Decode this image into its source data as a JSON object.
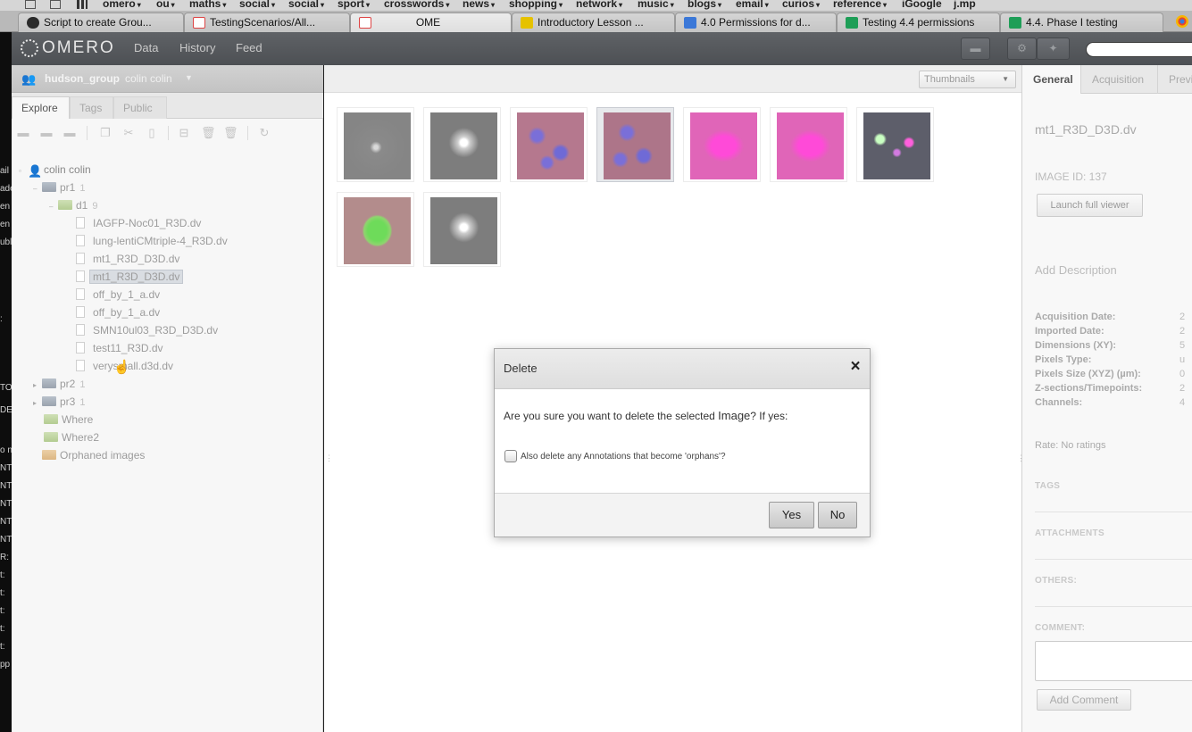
{
  "browser": {
    "bookmarks": [
      {
        "label": "omero",
        "caret": "▾"
      },
      {
        "label": "ou",
        "caret": "▾"
      },
      {
        "label": "maths",
        "caret": "▾"
      },
      {
        "label": "social",
        "caret": "▾"
      },
      {
        "label": "social",
        "caret": "▾"
      },
      {
        "label": "sport",
        "caret": "▾"
      },
      {
        "label": "crosswords",
        "caret": "▾"
      },
      {
        "label": "news",
        "caret": "▾"
      },
      {
        "label": "shopping",
        "caret": "▾"
      },
      {
        "label": "network",
        "caret": "▾"
      },
      {
        "label": "music",
        "caret": "▾"
      },
      {
        "label": "blogs",
        "caret": "▾"
      },
      {
        "label": "email",
        "caret": "▾"
      },
      {
        "label": "curios",
        "caret": "▾"
      },
      {
        "label": "reference",
        "caret": "▾"
      },
      {
        "label": "iGoogle",
        "caret": ""
      },
      {
        "label": "j.mp",
        "caret": ""
      }
    ],
    "tabs": [
      {
        "label": "Script to create Grou...",
        "fav_color": "#2b2b2b"
      },
      {
        "label": "TestingScenarios/All...",
        "fav_color": "#ffffff"
      },
      {
        "label": "OME",
        "fav_color": "#ffffff"
      },
      {
        "label": "Introductory Lesson ...",
        "fav_color": "#e6c200"
      },
      {
        "label": "4.0 Permissions for d...",
        "fav_color": "#3b78d8"
      },
      {
        "label": "Testing 4.4 permissions",
        "fav_color": "#1e9e57"
      },
      {
        "label": "4.4. Phase I testing",
        "fav_color": "#1e9e57"
      }
    ]
  },
  "desktop_strip": [
    "ail",
    "ade",
    "en",
    "en",
    "ubl",
    ":",
    "TO",
    "DE",
    "o n",
    "NT",
    "NT",
    "NT",
    "NT",
    "NT",
    "R:",
    "t: ",
    "t: ",
    "t: ",
    "t: ",
    "t: ",
    "pp"
  ],
  "header": {
    "logo_text": "OMERO",
    "nav": [
      "Data",
      "History",
      "Feed"
    ]
  },
  "left": {
    "group": "hudson_group",
    "user": "colin colin",
    "group_caret": "▼",
    "tabs": [
      "Explore",
      "Tags",
      "Public"
    ],
    "tree": {
      "root": "colin colin",
      "pr1": {
        "label": "pr1",
        "count": "1"
      },
      "d1": {
        "label": "d1",
        "count": "9"
      },
      "images": [
        "IAGFP-Noc01_R3D.dv",
        "lung-lentiCMtriple-4_R3D.dv",
        "mt1_R3D_D3D.dv",
        "mt1_R3D_D3D.dv",
        "off_by_1_a.dv",
        "off_by_1_a.dv",
        "SMN10ul03_R3D_D3D.dv",
        "test11_R3D.dv",
        "verysmall.d3d.dv"
      ],
      "pr2": {
        "label": "pr2",
        "count": "1"
      },
      "pr3": {
        "label": "pr3",
        "count": "1"
      },
      "where": "Where",
      "where2": "Where2",
      "orphaned": "Orphaned images"
    }
  },
  "center": {
    "view_select": "Thumbnails",
    "selected_thumbnail_index": 3
  },
  "dialog": {
    "title": "Delete",
    "question_pre": "Are you sure you want to delete the selected ",
    "question_type": "Image",
    "question_post": "? If yes:",
    "checkbox_label": "Also delete any Annotations that become 'orphans'?",
    "checkbox_checked": false,
    "yes": "Yes",
    "no": "No",
    "close": "×"
  },
  "right": {
    "tabs": [
      "General",
      "Acquisition",
      "Previ"
    ],
    "image_name": "mt1_R3D_D3D.dv",
    "image_id": "IMAGE ID: 137",
    "launch": "Launch full viewer",
    "add_description": "Add Description",
    "meta": [
      {
        "label": "Acquisition Date:",
        "value": "2"
      },
      {
        "label": "Imported Date:",
        "value": "2"
      },
      {
        "label": "Dimensions (XY):",
        "value": "5"
      },
      {
        "label": "Pixels Type:",
        "value": "u"
      },
      {
        "label": "Pixels Size (XYZ) (µm):",
        "value": "0"
      },
      {
        "label": "Z-sections/Timepoints:",
        "value": "2"
      },
      {
        "label": "Channels:",
        "value": "4"
      }
    ],
    "rate": "Rate: No ratings",
    "sections": [
      "TAGS",
      "ATTACHMENTS",
      "OTHERS:",
      "COMMENT:"
    ],
    "add_comment": "Add Comment"
  }
}
